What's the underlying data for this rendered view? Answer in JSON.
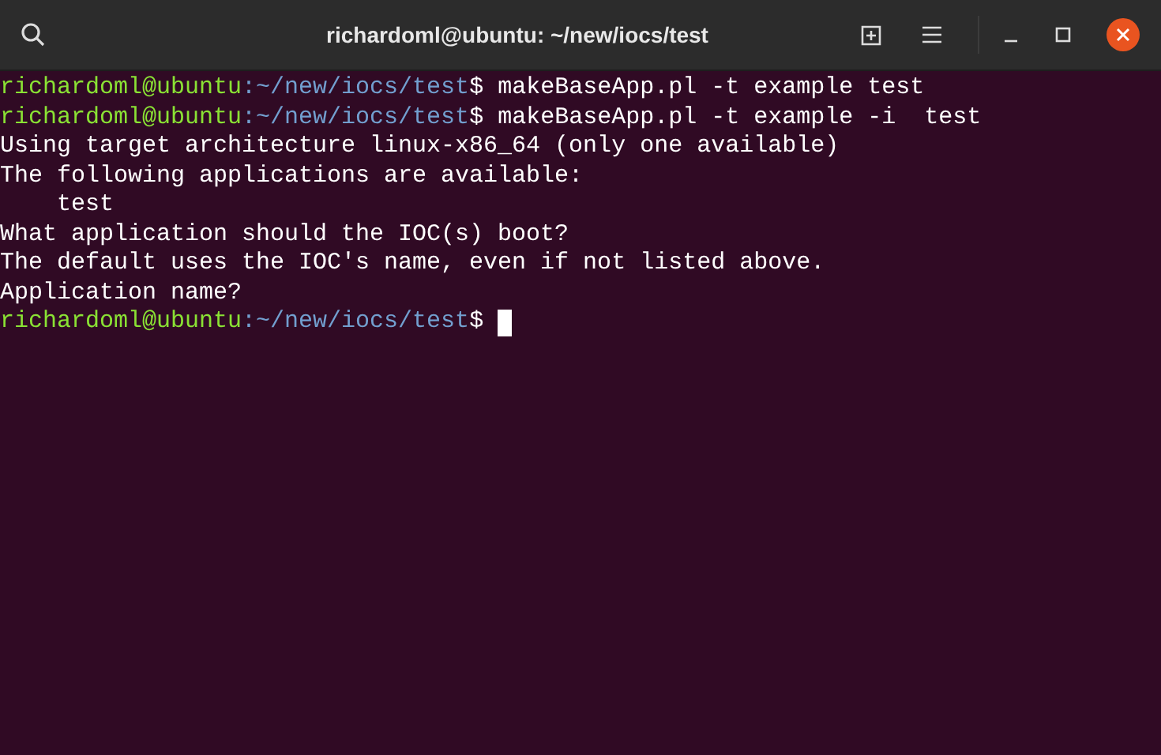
{
  "window": {
    "title": "richardoml@ubuntu: ~/new/iocs/test"
  },
  "lines": [
    {
      "kind": "prompt",
      "user_host": "richardoml@ubuntu",
      "path": ":~/new/iocs/test",
      "symbol": "$",
      "command": "makeBaseApp.pl -t example test",
      "cursor": false
    },
    {
      "kind": "prompt",
      "user_host": "richardoml@ubuntu",
      "path": ":~/new/iocs/test",
      "symbol": "$",
      "command": "makeBaseApp.pl -t example -i  test",
      "cursor": false
    },
    {
      "kind": "output",
      "text": "Using target architecture linux-x86_64 (only one available)"
    },
    {
      "kind": "output",
      "text": "The following applications are available:"
    },
    {
      "kind": "output",
      "text": "    test"
    },
    {
      "kind": "output",
      "text": "What application should the IOC(s) boot?"
    },
    {
      "kind": "output",
      "text": "The default uses the IOC's name, even if not listed above."
    },
    {
      "kind": "output",
      "text": "Application name?"
    },
    {
      "kind": "prompt",
      "user_host": "richardoml@ubuntu",
      "path": ":~/new/iocs/test",
      "symbol": "$",
      "cursor": true
    }
  ]
}
